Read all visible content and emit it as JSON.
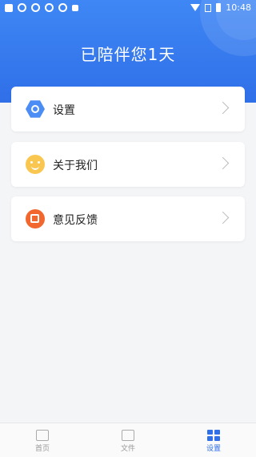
{
  "status_bar": {
    "time": "10:48"
  },
  "header": {
    "title": "已陪伴您1天",
    "accent": "#2f6fe8"
  },
  "menu": {
    "items": [
      {
        "label": "设置",
        "icon": "settings-hex-icon"
      },
      {
        "label": "关于我们",
        "icon": "smiley-icon"
      },
      {
        "label": "意见反馈",
        "icon": "feedback-icon"
      }
    ]
  },
  "tabbar": {
    "tabs": [
      {
        "label": "首页",
        "icon": "home-icon",
        "active": false
      },
      {
        "label": "文件",
        "icon": "folder-icon",
        "active": false
      },
      {
        "label": "设置",
        "icon": "settings-grid-icon",
        "active": true
      }
    ]
  }
}
